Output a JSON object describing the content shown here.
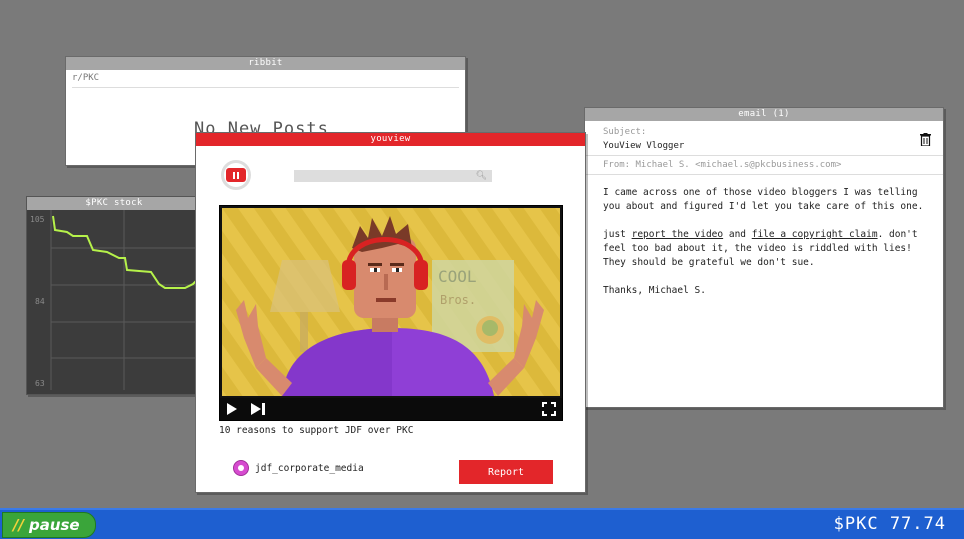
{
  "ribbit": {
    "title": "ribbit",
    "subreddit": "r/PKC",
    "empty_text": "No New Posts"
  },
  "stock": {
    "title": "$PKC stock",
    "ticks": [
      "105",
      "84",
      "63"
    ],
    "line_color": "#b6f24a"
  },
  "email": {
    "title": "email (1)",
    "subject_label": "Subject:",
    "subject": "YouView Vlogger",
    "from": "From: Michael S. <michael.s@pkcbusiness.com>",
    "p1": "I came across one of those video bloggers I was telling you about and figured I'd let you take care of this one.",
    "p2_a": "just ",
    "p2_link1": "report the video",
    "p2_b": " and ",
    "p2_link2": "file a copyright claim",
    "p2_c": ". don't feel too bad about it, the video is riddled with lies! They should be grateful we don't sue.",
    "p3": "Thanks, Michael S."
  },
  "youview": {
    "title": "youview",
    "video_title": "10 reasons to support JDF over PKC",
    "channel": "jdf_corporate_media",
    "report_label": "Report",
    "poster_text_1": "COOL",
    "poster_text_2": "Bros.",
    "accent": "#e3262a"
  },
  "taskbar": {
    "pause_label": "pause",
    "price": "$PKC 77.74"
  }
}
